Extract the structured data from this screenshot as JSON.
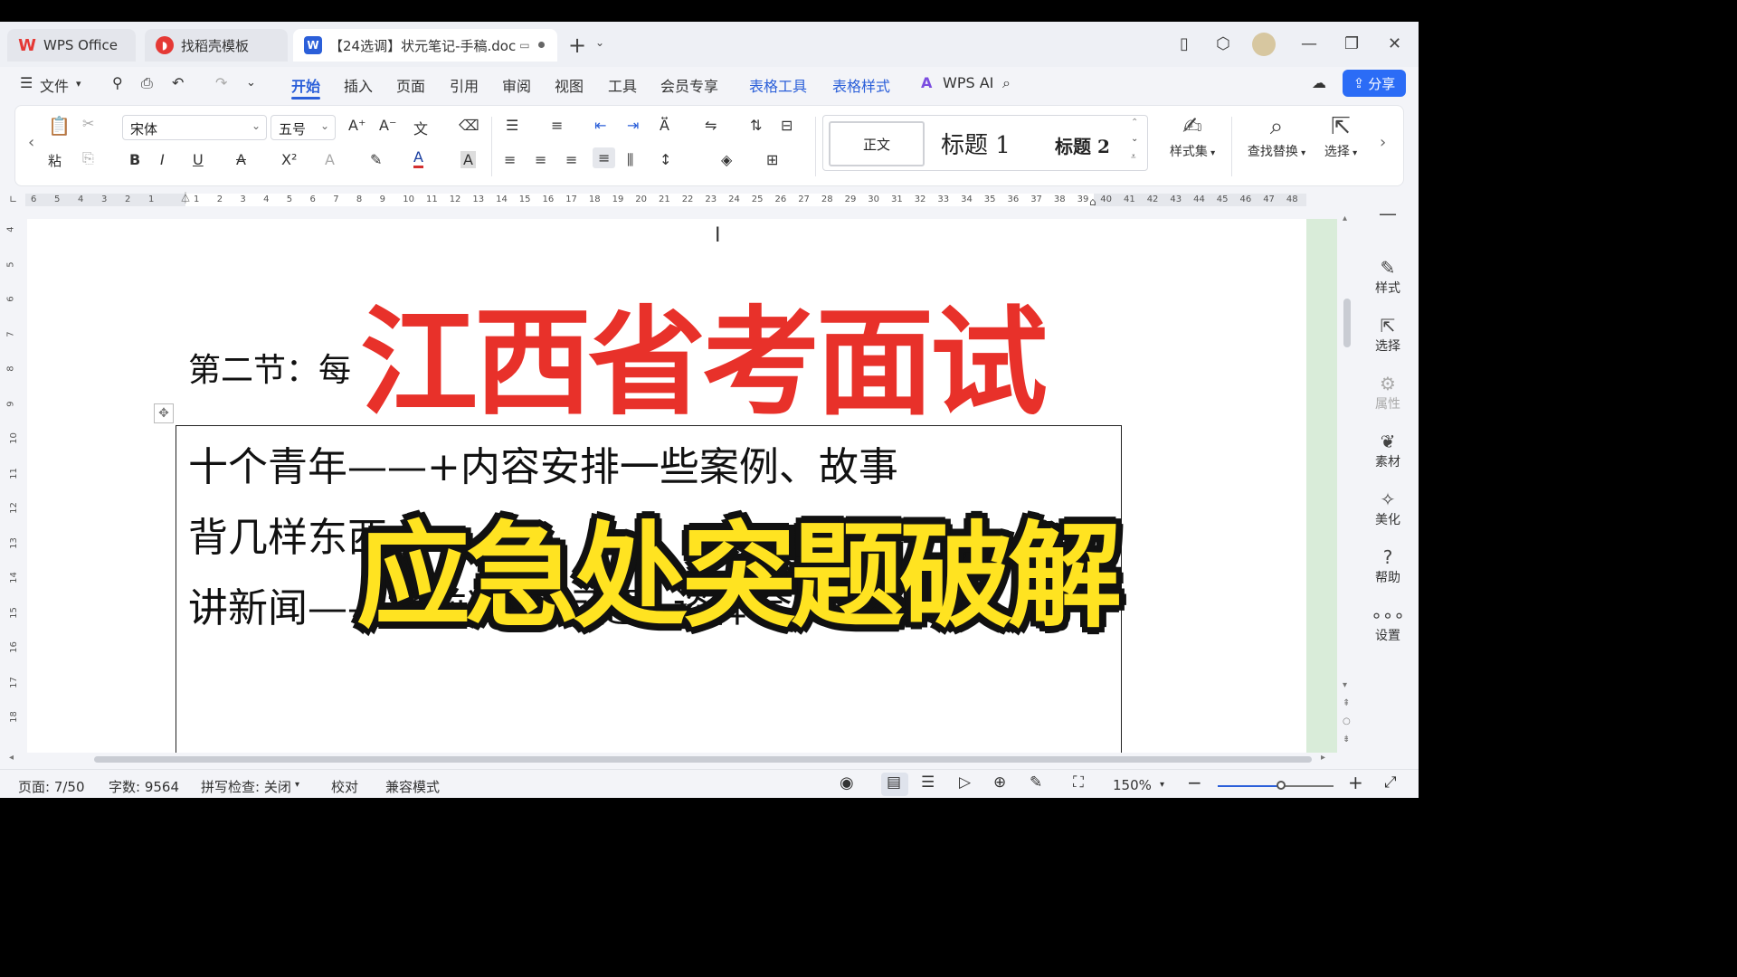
{
  "titlebar": {
    "tabs": [
      {
        "label": "WPS Office",
        "icon": "wps-logo-icon"
      },
      {
        "label": "找稻壳模板",
        "icon": "docer-icon"
      },
      {
        "label": "【24选调】状元笔记-手稿.doc",
        "icon": "word-doc-icon",
        "active": true
      }
    ],
    "new_tab": "+",
    "controls": {
      "minimize": "—",
      "restore": "❐",
      "close": "✕"
    }
  },
  "menubar": {
    "file": "文件",
    "items": [
      "开始",
      "插入",
      "页面",
      "引用",
      "审阅",
      "视图",
      "工具",
      "会员专享",
      "表格工具",
      "表格样式",
      "WPS AI"
    ],
    "active": "开始",
    "share": "分享"
  },
  "ribbon": {
    "paste": "粘",
    "font_name": "宋体",
    "font_size": "五号",
    "styles": {
      "normal": "正文",
      "h1": "标题 1",
      "h2": "标题 2"
    },
    "style_set": "样式集",
    "find_replace": "查找替换",
    "select": "选择"
  },
  "ruler": {
    "left_numbers": [
      "6",
      "5",
      "4",
      "3",
      "2",
      "1"
    ],
    "numbers": [
      "1",
      "2",
      "3",
      "4",
      "5",
      "6",
      "7",
      "8",
      "9",
      "10",
      "11",
      "12",
      "13",
      "14",
      "15",
      "16",
      "17",
      "18",
      "19",
      "20",
      "21",
      "22",
      "23",
      "24",
      "25",
      "26",
      "27",
      "28",
      "29",
      "30",
      "31",
      "32",
      "33",
      "34",
      "35",
      "36",
      "37",
      "38",
      "39",
      "40",
      "41",
      "42",
      "43",
      "44",
      "45",
      "46",
      "47",
      "48"
    ],
    "vertical": [
      "4",
      "5",
      "6",
      "7",
      "8",
      "9",
      "10",
      "11",
      "12",
      "13",
      "14",
      "15",
      "16",
      "17",
      "18"
    ]
  },
  "document": {
    "heading": "第二节：每",
    "heading_partial": "⁄ ⁄ 义",
    "lines": [
      "十个青年——+内容安排一些案例、故事",
      "背几样东西",
      "讲新闻——提前准备-问题+谈体会"
    ]
  },
  "overlay": {
    "title_red": "江西省考面试",
    "title_yellow": "应急处突题破解",
    "red": "#e8312a",
    "yellow": "#ffe321"
  },
  "sidepanel": {
    "items": [
      {
        "label": "样式",
        "icon": "pen-style-icon"
      },
      {
        "label": "选择",
        "icon": "cursor-select-icon"
      },
      {
        "label": "属性",
        "icon": "sliders-icon"
      },
      {
        "label": "素材",
        "icon": "material-icon"
      },
      {
        "label": "美化",
        "icon": "beautify-icon"
      },
      {
        "label": "帮助",
        "icon": "help-icon"
      },
      {
        "label": "设置",
        "icon": "more-icon"
      }
    ]
  },
  "statusbar": {
    "page": "页面: 7/50",
    "word_count": "字数: 9564",
    "spell_check": "拼写检查: 关闭",
    "proofread": "校对",
    "compat_mode": "兼容模式",
    "zoom": "150%",
    "zoom_level": 0.55
  },
  "colors": {
    "accent": "#2b5fd9",
    "share": "#2b6cf6"
  }
}
